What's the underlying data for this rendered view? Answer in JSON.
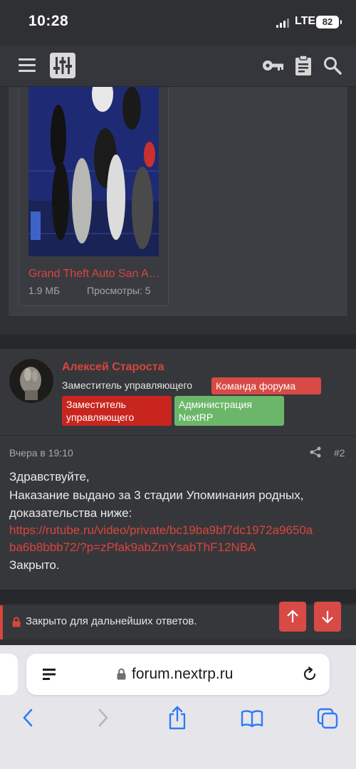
{
  "status_bar": {
    "time": "10:28",
    "network": "LTE",
    "battery": "82"
  },
  "attachment": {
    "title": "Grand Theft Auto San Andreas",
    "size": "1.9 МБ",
    "views": "Просмотры: 5"
  },
  "user": {
    "name": "Алексей Староста",
    "title": "Заместитель управляющего",
    "badges": {
      "team": "Команда форума",
      "deputy_line1": "Заместитель",
      "deputy_line2": "управляющего",
      "admin_line1": "Администрация",
      "admin_line2": "NextRP"
    }
  },
  "post": {
    "date": "Вчера в 19:10",
    "number": "#2",
    "lines": [
      "Здравствуйте,",
      "Наказание выдано за 3 стадии Упоминания родных,",
      "доказательства ниже:"
    ],
    "link_line1": "https://rutube.ru/video/private/bc19ba9bf7dc1972a9650a",
    "link_line2": "ba6b8bbb72/?p=zPfak9abZmYsabThF12NBA",
    "closing": "Закрыто."
  },
  "closed_notice": "Закрыто для дальнейших ответов.",
  "browser": {
    "url": "forum.nextrp.ru"
  },
  "colors": {
    "accent": "#d8453c",
    "badge_team": "#d84a45",
    "badge_deputy": "#c9251f",
    "badge_admin": "#6cb66a",
    "background": "#2f3034",
    "panel": "#36373b"
  },
  "icons": {
    "menu": "menu-icon",
    "logo": "equalizer-logo-icon",
    "key": "key-icon",
    "clipboard": "clipboard-icon",
    "search": "search-icon",
    "share": "share-icon",
    "lock": "lock-icon",
    "up": "arrow-up-icon",
    "down": "arrow-down-icon",
    "reader": "reader-icon",
    "reload": "reload-icon",
    "back": "back-icon",
    "forward": "forward-icon",
    "share_sheet": "share-sheet-icon",
    "bookmarks": "bookmarks-icon",
    "tabs": "tabs-icon"
  }
}
